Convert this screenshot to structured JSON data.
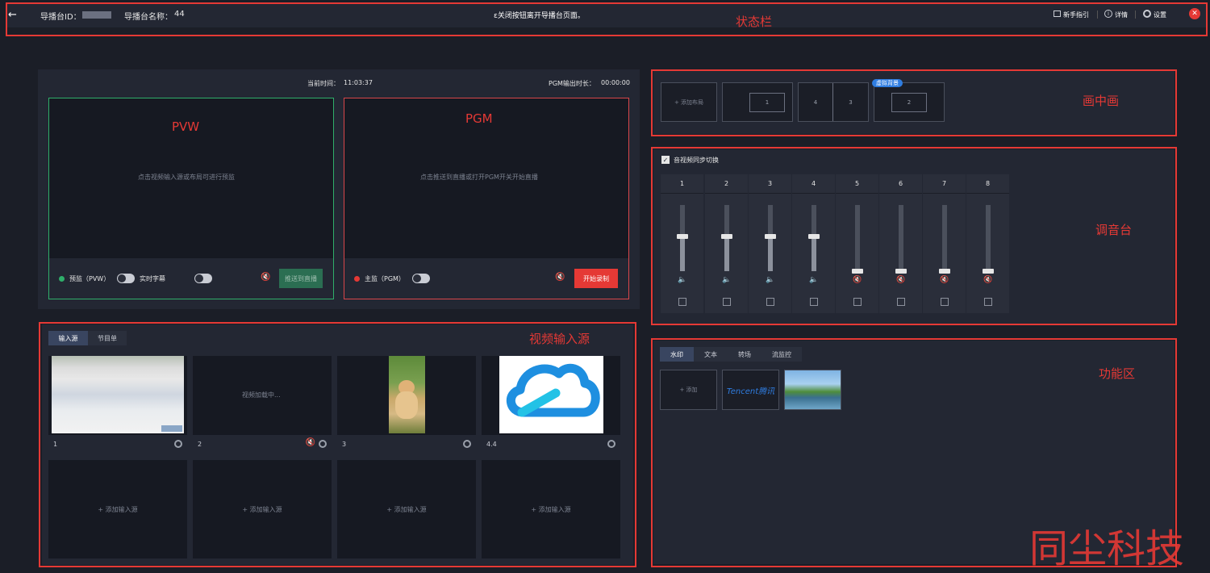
{
  "status_bar": {
    "back_icon": "arrow-left-icon",
    "id_label": "导播台ID：",
    "name_label": "导播台名称：",
    "name_value": "44",
    "notice": "ɛ关闭按钮离开导播台页面。",
    "guide_label": "新手指引",
    "detail_label": "详情",
    "settings_label": "设置"
  },
  "monitor": {
    "current_time_label": "当前时间：",
    "current_time_value": "11:03:37",
    "pgm_duration_label": "PGM输出时长：",
    "pgm_duration_value": "00:00:00",
    "pvw": {
      "title": "PVW",
      "hint": "点击视频输入源或布局可进行预监",
      "toggle_label": "预监（PVW）",
      "subtitle_label": "实时字幕",
      "push_button": "推送到直播",
      "dot_color": "#2fae6a"
    },
    "pgm": {
      "title": "PGM",
      "hint": "点击推送到直播或打开PGM开关开始直播",
      "toggle_label": "主监（PGM）",
      "record_button": "开始录制",
      "dot_color": "#e53935"
    }
  },
  "inputs": {
    "tabs": [
      "输入源",
      "节目单"
    ],
    "sources": [
      {
        "label": "1",
        "loading": ""
      },
      {
        "label": "2",
        "loading": "视频加载中..."
      },
      {
        "label": "3",
        "loading": ""
      },
      {
        "label": "4.4",
        "loading": ""
      }
    ],
    "add_label": "+ 添加输入源"
  },
  "pip": {
    "add_layout": "+ 添加布局",
    "cards": [
      {
        "boxes": [
          "1"
        ]
      },
      {
        "boxes": [
          "4",
          "3"
        ]
      },
      {
        "boxes": [
          "2"
        ],
        "badge": "虚拟背景"
      }
    ]
  },
  "mixer": {
    "sync_label": "音视频同步切换",
    "channels": [
      {
        "label": "1",
        "level": 0.52,
        "muted": false
      },
      {
        "label": "2",
        "level": 0.52,
        "muted": false
      },
      {
        "label": "3",
        "level": 0.52,
        "muted": false
      },
      {
        "label": "4",
        "level": 0.52,
        "muted": false
      },
      {
        "label": "5",
        "level": 0.0,
        "muted": true
      },
      {
        "label": "6",
        "level": 0.0,
        "muted": true
      },
      {
        "label": "7",
        "level": 0.0,
        "muted": true
      },
      {
        "label": "8",
        "level": 0.0,
        "muted": true
      }
    ]
  },
  "function_area": {
    "tabs": [
      "水印",
      "文本",
      "转场",
      "流监控"
    ],
    "add_label": "+ 添加",
    "tencent_text": "Tencent腾讯"
  },
  "annotations": {
    "status_bar": "状态栏",
    "pip": "画中画",
    "mixer": "调音台",
    "video_input": "视频输入源",
    "function_area": "功能区"
  },
  "watermark": "同尘科技",
  "colors": {
    "accent_red": "#e53935",
    "accent_green": "#2fae6a",
    "badge_blue": "#2f7de1"
  }
}
